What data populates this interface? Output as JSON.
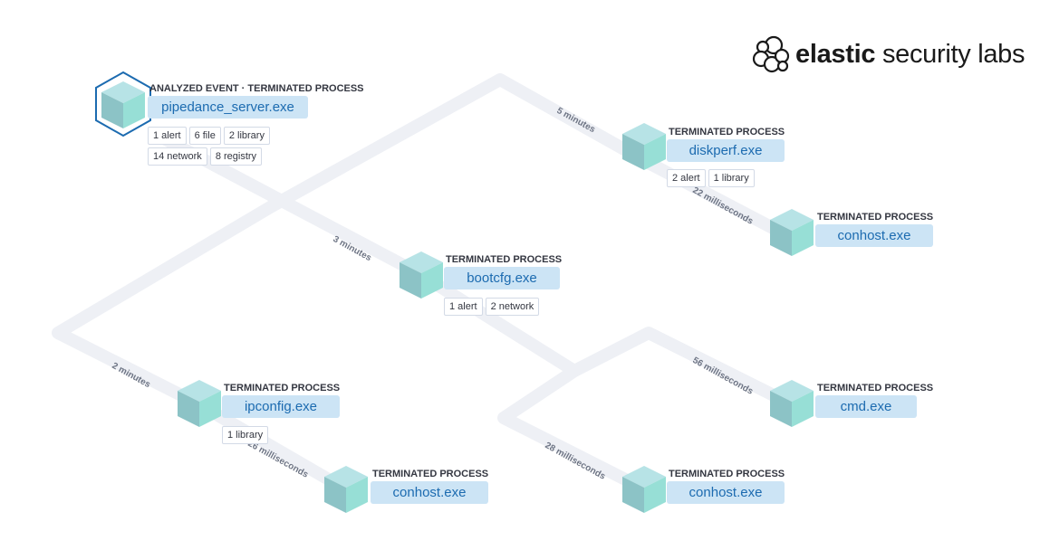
{
  "brand": {
    "word1": "elastic",
    "word2": " security labs"
  },
  "nodes": [
    {
      "id": "pipedance",
      "type": "ANALYZED EVENT · TERMINATED PROCESS",
      "name": "pipedance_server.exe",
      "analyzed": true,
      "badges": [
        "1 alert",
        "6 file",
        "2 library",
        "14 network",
        "8 registry"
      ]
    },
    {
      "id": "diskperf",
      "type": "TERMINATED PROCESS",
      "name": "diskperf.exe",
      "badges": [
        "2 alert",
        "1 library"
      ]
    },
    {
      "id": "conhost1",
      "type": "TERMINATED PROCESS",
      "name": "conhost.exe",
      "badges": []
    },
    {
      "id": "bootcfg",
      "type": "TERMINATED PROCESS",
      "name": "bootcfg.exe",
      "badges": [
        "1 alert",
        "2 network"
      ]
    },
    {
      "id": "ipconfig",
      "type": "TERMINATED PROCESS",
      "name": "ipconfig.exe",
      "badges": [
        "1 library"
      ]
    },
    {
      "id": "conhost2",
      "type": "TERMINATED PROCESS",
      "name": "conhost.exe",
      "badges": []
    },
    {
      "id": "cmd",
      "type": "TERMINATED PROCESS",
      "name": "cmd.exe",
      "badges": []
    },
    {
      "id": "conhost3",
      "type": "TERMINATED PROCESS",
      "name": "conhost.exe",
      "badges": []
    }
  ],
  "edges": [
    {
      "from": "pipedance",
      "to": "diskperf",
      "label": "5 minutes"
    },
    {
      "from": "diskperf",
      "to": "conhost1",
      "label": "22 milliseconds"
    },
    {
      "from": "pipedance",
      "to": "bootcfg",
      "label": "3 minutes"
    },
    {
      "from": "pipedance",
      "to": "ipconfig",
      "label": "2 minutes"
    },
    {
      "from": "ipconfig",
      "to": "conhost2",
      "label": "26 milliseconds"
    },
    {
      "from": "bootcfg",
      "to": "cmd",
      "label": "56 milliseconds"
    },
    {
      "from": "bootcfg",
      "to": "conhost3",
      "label": "28 milliseconds"
    }
  ]
}
